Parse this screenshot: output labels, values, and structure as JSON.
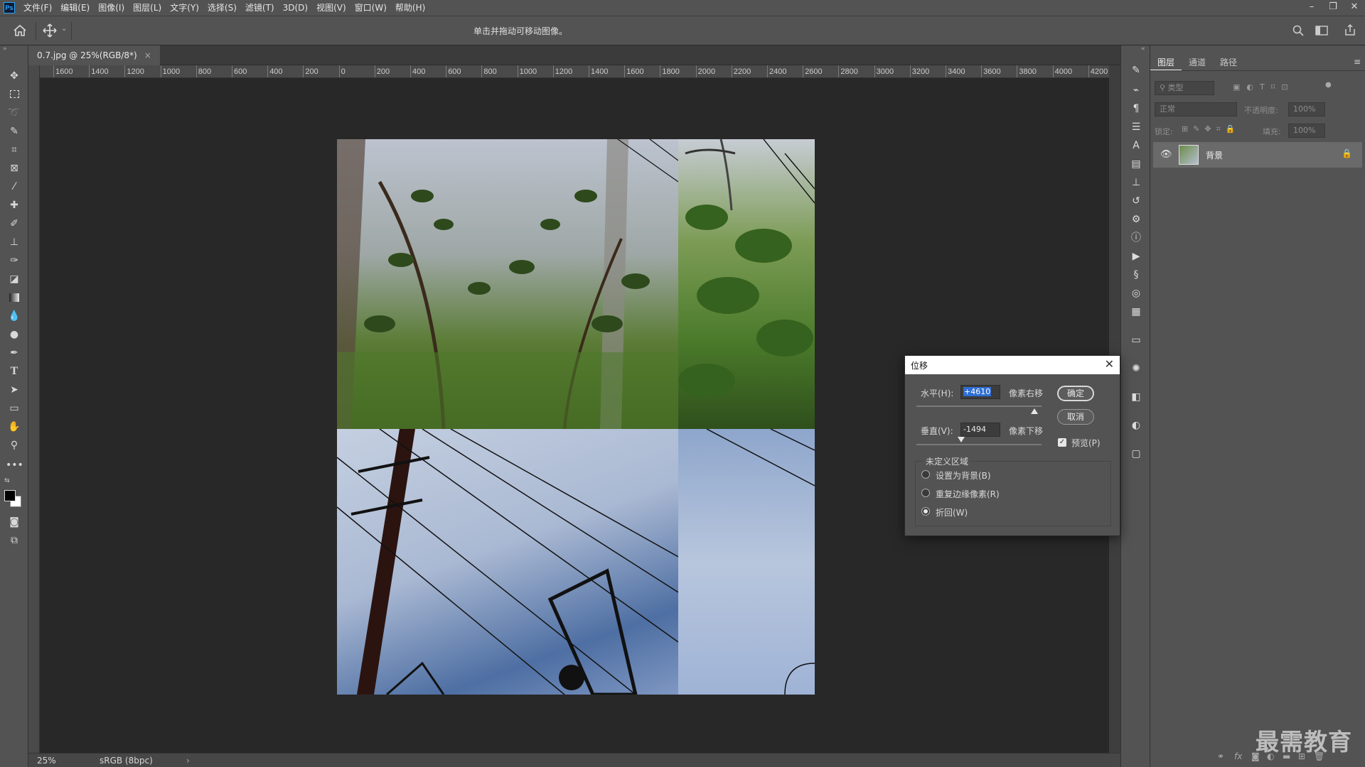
{
  "menubar": {
    "logo": "Ps",
    "items": [
      "文件(F)",
      "编辑(E)",
      "图像(I)",
      "图层(L)",
      "文字(Y)",
      "选择(S)",
      "滤镜(T)",
      "3D(D)",
      "视图(V)",
      "窗口(W)",
      "帮助(H)"
    ],
    "window_controls": [
      "–",
      "❐",
      "✕"
    ]
  },
  "optionsbar": {
    "hint": "单击并拖动可移动图像。",
    "home_icon": "home-icon",
    "move_icon": "move-tool-icon"
  },
  "document": {
    "tab_title": "0.7.jpg @ 25%(RGB/8*)",
    "tab_close": "×",
    "zoom": "25%",
    "color_profile": "sRGB (8bpc)",
    "status_arrow": "›",
    "ruler_top": [
      "1600",
      "1400",
      "1200",
      "1000",
      "800",
      "600",
      "400",
      "200",
      "0",
      "200",
      "400",
      "600",
      "800",
      "1000",
      "1200",
      "1400",
      "1600",
      "1800",
      "2000",
      "2200",
      "2400",
      "2600",
      "2800",
      "3000",
      "3200",
      "3400",
      "3600",
      "3800",
      "4000",
      "4200"
    ]
  },
  "layers_panel": {
    "tabs": [
      "图层",
      "通道",
      "路径"
    ],
    "kind_filter": "类型",
    "blend_mode": "正常",
    "opacity_label": "不透明度:",
    "opacity_value": "100%",
    "lock_label": "锁定:",
    "fill_label": "填充:",
    "fill_value": "100%",
    "layer_name": "背景"
  },
  "offset_dialog": {
    "title": "位移",
    "horizontal_label": "水平(H):",
    "horizontal_value": "+4610",
    "horizontal_unit": "像素右移",
    "vertical_label": "垂直(V):",
    "vertical_value": "-1494",
    "vertical_unit": "像素下移",
    "ok": "确定",
    "cancel": "取消",
    "preview": "预览(P)",
    "preview_checked": true,
    "undefined_area_title": "未定义区域",
    "options": [
      "设置为背景(B)",
      "重复边缘像素(R)",
      "折回(W)"
    ],
    "selected_option": "折回(W)"
  },
  "watermark": "最需教育"
}
